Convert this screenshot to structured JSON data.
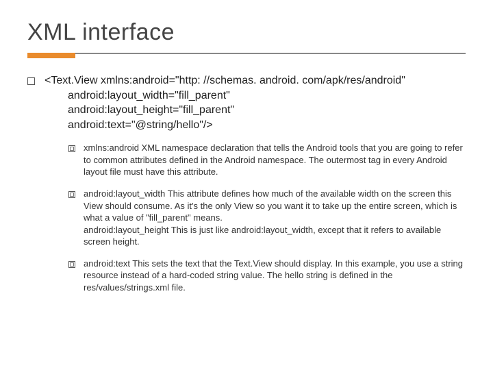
{
  "title": "XML interface",
  "code": {
    "l1": "<Text.View xmlns:android=\"http: //schemas. android. com/apk/res/android\"",
    "l2": "android:layout_width=\"fill_parent\"",
    "l3": "android:layout_height=\"fill_parent\"",
    "l4": "android:text=\"@string/hello\"/>"
  },
  "items": [
    {
      "text": "xmlns:android  XML namespace declaration that tells the Android tools that you are going to refer to common attributes defined in the Android namespace. The outermost tag in every Android layout file must have this attribute."
    },
    {
      "text": "android:layout_width This attribute defines how much of the available width on the screen this View should consume. As it's the only View so you want it to take up the entire screen, which is what a value of \"fill_parent\" means.\nandroid:layout_height This is just like android:layout_width, except that it refers to available screen height."
    },
    {
      "text": "android:text This sets the text that the Text.View should display. In this example, you use a string resource instead of a hard-coded string value. The hello string is defined in the res/values/strings.xml  file."
    }
  ]
}
